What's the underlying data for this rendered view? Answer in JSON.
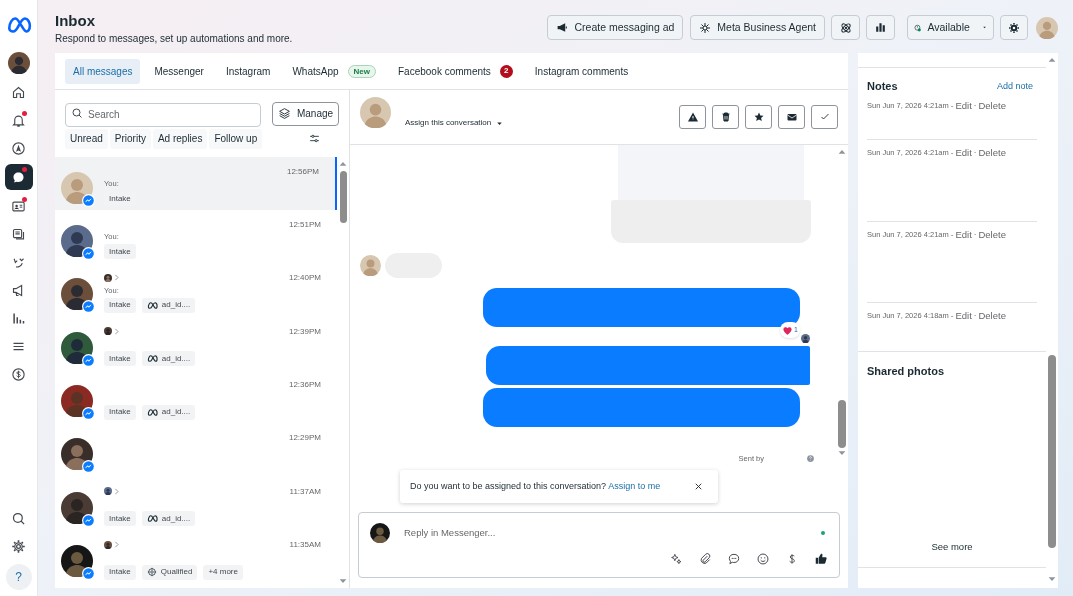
{
  "header": {
    "title": "Inbox",
    "subtitle": "Respond to messages, set up automations and more."
  },
  "toolbar": [
    {
      "kind": "ad",
      "label": "Create messaging ad"
    },
    {
      "kind": "agent",
      "label": "Meta Business Agent"
    },
    {
      "kind": "status",
      "label": "Available"
    }
  ],
  "rail": {
    "top": [
      {
        "kind": "home",
        "selected": false
      },
      {
        "kind": "bell",
        "selected": false,
        "badge": true
      },
      {
        "kind": "compass",
        "selected": false
      },
      {
        "kind": "chat",
        "selected": true,
        "badge": true
      },
      {
        "kind": "contact",
        "selected": false,
        "badge": true
      },
      {
        "kind": "pages",
        "selected": false
      },
      {
        "kind": "leads",
        "selected": false
      },
      {
        "kind": "megaphone",
        "selected": false
      },
      {
        "kind": "bars",
        "selected": false
      },
      {
        "kind": "menu",
        "selected": false
      },
      {
        "kind": "dollar",
        "selected": false
      }
    ],
    "bottom": [
      {
        "kind": "search",
        "selected": false
      },
      {
        "kind": "settings",
        "selected": false
      }
    ],
    "help_label": "?"
  },
  "tabs": [
    {
      "label": "All messages",
      "selected": true
    },
    {
      "label": "Messenger",
      "selected": false
    },
    {
      "label": "Instagram",
      "selected": false
    },
    {
      "label": "WhatsApp",
      "selected": false,
      "tag": "New"
    },
    {
      "label": "Facebook comments",
      "selected": false,
      "count": "2"
    },
    {
      "label": "Instagram comments",
      "selected": false
    }
  ],
  "search": {
    "placeholder": "Search"
  },
  "manage_button": "Manage",
  "filters": [
    "Unread",
    "Priority",
    "Ad replies",
    "Follow up"
  ],
  "conversations": [
    {
      "time": "12:56PM",
      "preview": "You:",
      "agent_marker": false,
      "selected": true,
      "tags": [
        {
          "kind": "label",
          "text": "Intake"
        }
      ]
    },
    {
      "time": "12:51PM",
      "preview": "You:",
      "agent_marker": false,
      "selected": false,
      "tags": [
        {
          "kind": "label",
          "text": "Intake"
        }
      ]
    },
    {
      "time": "12:40PM",
      "preview": "You:",
      "agent_marker": true,
      "selected": false,
      "tags": [
        {
          "kind": "label",
          "text": "Intake"
        },
        {
          "kind": "ad",
          "text": "ad_id...."
        }
      ]
    },
    {
      "time": "12:39PM",
      "agent_marker": true,
      "selected": false,
      "tags": [
        {
          "kind": "label",
          "text": "Intake"
        },
        {
          "kind": "ad",
          "text": "ad_id...."
        }
      ]
    },
    {
      "time": "12:36PM",
      "agent_marker": false,
      "selected": false,
      "tags": [
        {
          "kind": "label",
          "text": "Intake"
        },
        {
          "kind": "ad",
          "text": "ad_id...."
        }
      ]
    },
    {
      "time": "12:29PM",
      "agent_marker": false,
      "selected": false
    },
    {
      "time": "11:37AM",
      "agent_marker": true,
      "selected": false,
      "tags": [
        {
          "kind": "label",
          "text": "Intake"
        },
        {
          "kind": "ad",
          "text": "ad_id...."
        }
      ]
    },
    {
      "time": "11:35AM",
      "agent_marker": true,
      "selected": false,
      "tags": [
        {
          "kind": "label",
          "text": "Intake"
        },
        {
          "kind": "stage",
          "text": "Qualified"
        },
        {
          "kind": "more",
          "text": "+4 more"
        }
      ]
    }
  ],
  "chat": {
    "assign_label": "Assign this conversation",
    "messages": [
      {
        "kind": "card"
      },
      {
        "kind": "incoming"
      },
      {
        "kind": "outgoing",
        "reaction": "1"
      },
      {
        "kind": "outgoing",
        "wide": true
      },
      {
        "kind": "outgoing"
      }
    ],
    "sent_by": "Sent by",
    "banner": {
      "text": "Do you want to be assigned to this conversation?",
      "link": "Assign to me"
    },
    "reply": {
      "placeholder": "Reply in Messenger..."
    }
  },
  "notes": {
    "title": "Notes",
    "add_label": "Add note",
    "date_separator": "-",
    "separator": "·",
    "items": [
      {
        "date": "Sun Jun 7, 2026 4:21am",
        "actions": [
          "Edit",
          "Delete"
        ]
      },
      {
        "date": "Sun Jun 7, 2026 4:21am",
        "actions": [
          "Edit",
          "Delete"
        ]
      },
      {
        "date": "Sun Jun 7, 2026 4:21am",
        "actions": [
          "Edit",
          "Delete"
        ]
      },
      {
        "date": "Sun Jun 7, 2026 4:18am",
        "actions": [
          "Edit",
          "Delete"
        ]
      }
    ]
  },
  "shared_photos": {
    "title": "Shared photos",
    "more_label": "See more"
  }
}
